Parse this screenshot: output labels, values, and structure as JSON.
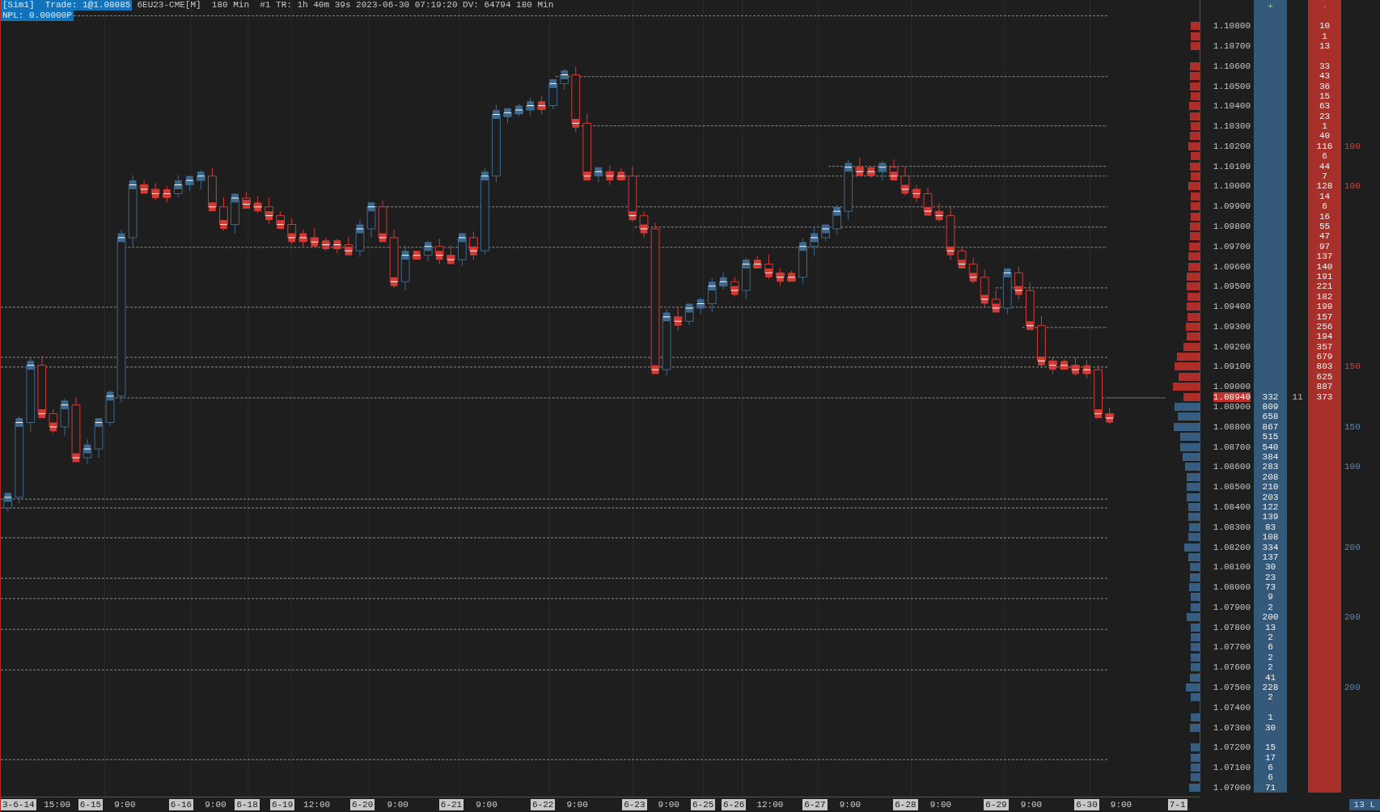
{
  "header": {
    "account_trade": "[Sim1]  Trade: 1@1.08085",
    "info": "6EU23-CME[M]  180 Min  #1 TR: 1h 40m 39s 2023-06-30 07:19:20 DV: 64794 180 Min",
    "npl": "NPL: 0.00000P"
  },
  "ladder": {
    "bid_header": "+",
    "ask_header": "-",
    "last_price": "1.08940",
    "rows": [
      {
        "price": "1.10800",
        "ask": "10"
      },
      {
        "ask": "1"
      },
      {
        "price": "1.10700",
        "ask": "13"
      },
      {},
      {
        "price": "1.10600",
        "ask": "33"
      },
      {
        "ask": "43"
      },
      {
        "price": "1.10500",
        "ask": "36"
      },
      {
        "ask": "15"
      },
      {
        "price": "1.10400",
        "ask": "63"
      },
      {
        "ask": "23"
      },
      {
        "price": "1.10300",
        "ask": "1"
      },
      {
        "ask": "40"
      },
      {
        "price": "1.10200",
        "ask": "116",
        "note": {
          "text": "100",
          "color": "#cc4540"
        }
      },
      {
        "ask": "6"
      },
      {
        "price": "1.10100",
        "ask": "44"
      },
      {
        "ask": "7"
      },
      {
        "price": "1.10000",
        "ask": "128",
        "note": {
          "text": "100",
          "color": "#cc4540"
        }
      },
      {
        "ask": "14"
      },
      {
        "price": "1.09900",
        "ask": "6"
      },
      {
        "ask": "16"
      },
      {
        "price": "1.09800",
        "ask": "55"
      },
      {
        "ask": "47"
      },
      {
        "price": "1.09700",
        "ask": "97"
      },
      {
        "ask": "137"
      },
      {
        "price": "1.09600",
        "ask": "140"
      },
      {
        "ask": "191"
      },
      {
        "price": "1.09500",
        "ask": "221"
      },
      {
        "ask": "182"
      },
      {
        "price": "1.09400",
        "ask": "199"
      },
      {
        "ask": "157"
      },
      {
        "price": "1.09300",
        "ask": "256"
      },
      {
        "ask": "194"
      },
      {
        "price": "1.09200",
        "ask": "357"
      },
      {
        "ask": "679"
      },
      {
        "price": "1.09100",
        "ask": "803",
        "note": {
          "text": "150",
          "color": "#cc4540"
        }
      },
      {
        "ask": "625"
      },
      {
        "price": "1.09000",
        "ask": "887"
      },
      {
        "ask": "373",
        "bid": "332",
        "trade": "11"
      },
      {
        "price": "1.08900",
        "bid": "809"
      },
      {
        "bid": "658"
      },
      {
        "price": "1.08800",
        "bid": "867",
        "note": {
          "text": "150",
          "color": "#5f88b0"
        }
      },
      {
        "bid": "515"
      },
      {
        "price": "1.08700",
        "bid": "540"
      },
      {
        "bid": "384"
      },
      {
        "price": "1.08600",
        "bid": "283",
        "note": {
          "text": "100",
          "color": "#5f88b0"
        }
      },
      {
        "bid": "208"
      },
      {
        "price": "1.08500",
        "bid": "210"
      },
      {
        "bid": "203"
      },
      {
        "price": "1.08400",
        "bid": "122"
      },
      {
        "bid": "139"
      },
      {
        "price": "1.08300",
        "bid": "83"
      },
      {
        "bid": "108"
      },
      {
        "price": "1.08200",
        "bid": "334",
        "note": {
          "text": "200",
          "color": "#5f88b0"
        }
      },
      {
        "bid": "137"
      },
      {
        "price": "1.08100",
        "bid": "30"
      },
      {
        "bid": "23"
      },
      {
        "price": "1.08000",
        "bid": "73"
      },
      {
        "bid": "9"
      },
      {
        "price": "1.07900",
        "bid": "2"
      },
      {
        "bid": "200",
        "note": {
          "text": "200",
          "color": "#5f88b0"
        }
      },
      {
        "price": "1.07800",
        "bid": "13"
      },
      {
        "bid": "2"
      },
      {
        "price": "1.07700",
        "bid": "6"
      },
      {
        "bid": "2"
      },
      {
        "price": "1.07600",
        "bid": "2"
      },
      {
        "bid": "41"
      },
      {
        "price": "1.07500",
        "bid": "228",
        "note": {
          "text": "200",
          "color": "#5f88b0"
        }
      },
      {
        "bid": "2"
      },
      {
        "price": "1.07400"
      },
      {
        "bid": "1"
      },
      {
        "price": "1.07300",
        "bid": "30"
      },
      {},
      {
        "price": "1.07200",
        "bid": "15"
      },
      {
        "bid": "17"
      },
      {
        "price": "1.07100",
        "bid": "6"
      },
      {
        "bid": "6"
      },
      {
        "price": "1.07000",
        "bid": "71"
      }
    ]
  },
  "time_axis": [
    {
      "text": "3-6-14",
      "kind": "date"
    },
    {
      "text": "15:00",
      "kind": "time"
    },
    {
      "text": "6-15",
      "kind": "date"
    },
    {
      "text": "9:00",
      "kind": "time"
    },
    {
      "text": "6-16",
      "kind": "date"
    },
    {
      "text": "9:00",
      "kind": "time"
    },
    {
      "text": "6-18",
      "kind": "date"
    },
    {
      "text": "6-19",
      "kind": "date"
    },
    {
      "text": "12:00",
      "kind": "time"
    },
    {
      "text": "6-20",
      "kind": "date"
    },
    {
      "text": "9:00",
      "kind": "time"
    },
    {
      "text": "6-21",
      "kind": "date"
    },
    {
      "text": "9:00",
      "kind": "time"
    },
    {
      "text": "6-22",
      "kind": "date"
    },
    {
      "text": "9:00",
      "kind": "time"
    },
    {
      "text": "6-23",
      "kind": "date"
    },
    {
      "text": "9:00",
      "kind": "time"
    },
    {
      "text": "6-25",
      "kind": "date"
    },
    {
      "text": "6-26",
      "kind": "date"
    },
    {
      "text": "12:00",
      "kind": "time"
    },
    {
      "text": "6-27",
      "kind": "date"
    },
    {
      "text": "9:00",
      "kind": "time"
    },
    {
      "text": "6-28",
      "kind": "date"
    },
    {
      "text": "9:00",
      "kind": "time"
    },
    {
      "text": "6-29",
      "kind": "date"
    },
    {
      "text": "9:00",
      "kind": "time"
    },
    {
      "text": "6-30",
      "kind": "date"
    },
    {
      "text": "9:00",
      "kind": "time"
    },
    {
      "text": "7-1",
      "kind": "date"
    }
  ],
  "corner_badge": "13 L"
}
